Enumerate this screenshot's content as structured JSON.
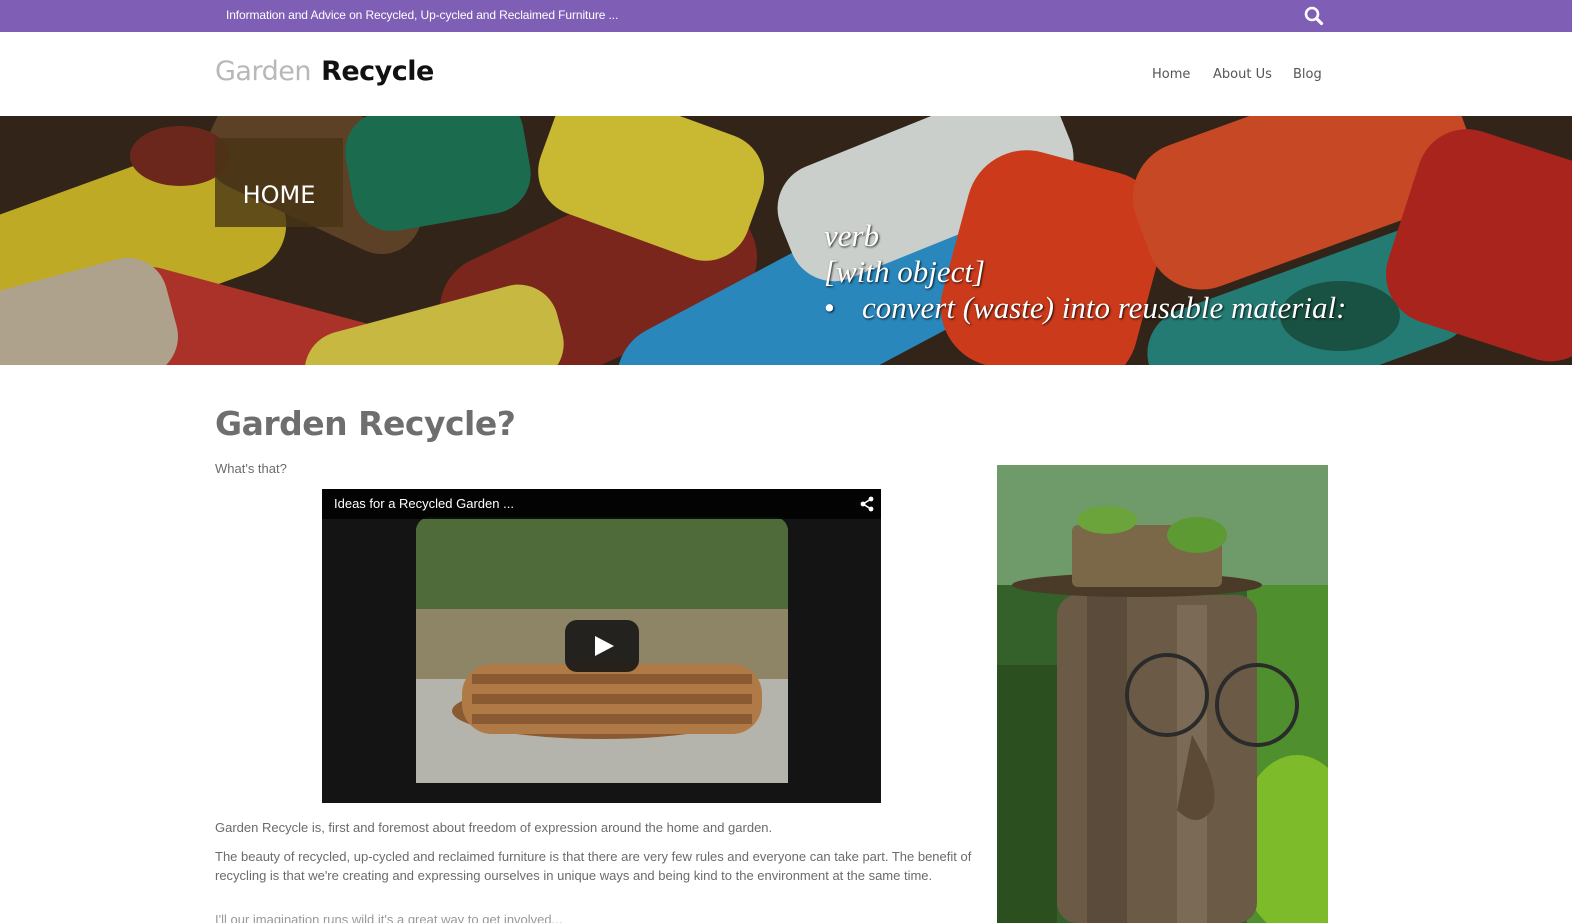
{
  "topbar": {
    "tagline": "Information and Advice on Recycled, Up-cycled and Reclaimed Furniture ...",
    "search_icon": "search-icon",
    "background_color": "#7f5fb5"
  },
  "header": {
    "logo_light": "Garden",
    "logo_dark": "Recycle",
    "nav": [
      {
        "label": "Home"
      },
      {
        "label": "About Us"
      },
      {
        "label": "Blog"
      }
    ]
  },
  "hero": {
    "page_label": "HOME",
    "quote_line1": "verb",
    "quote_line2": "[with object]",
    "quote_bullet": "•",
    "quote_line3": "convert (waste) into reusable material:"
  },
  "main": {
    "title": "Garden Recycle?",
    "subtitle": "What's that?",
    "video": {
      "title": "Ideas for a Recycled Garden ...",
      "share_icon": "share-icon",
      "play_icon": "play-icon"
    },
    "paragraphs": [
      "Garden Recycle is, first and foremost about freedom of expression around the home and garden.",
      "The beauty of recycled, up-cycled and reclaimed furniture is that there are very few rules and everyone can take part. The benefit of recycling is that we're creating and expressing ourselves in unique ways and being kind to the environment at the same time.",
      "I'll our imagination runs wild it's a great way to get involved..."
    ]
  }
}
